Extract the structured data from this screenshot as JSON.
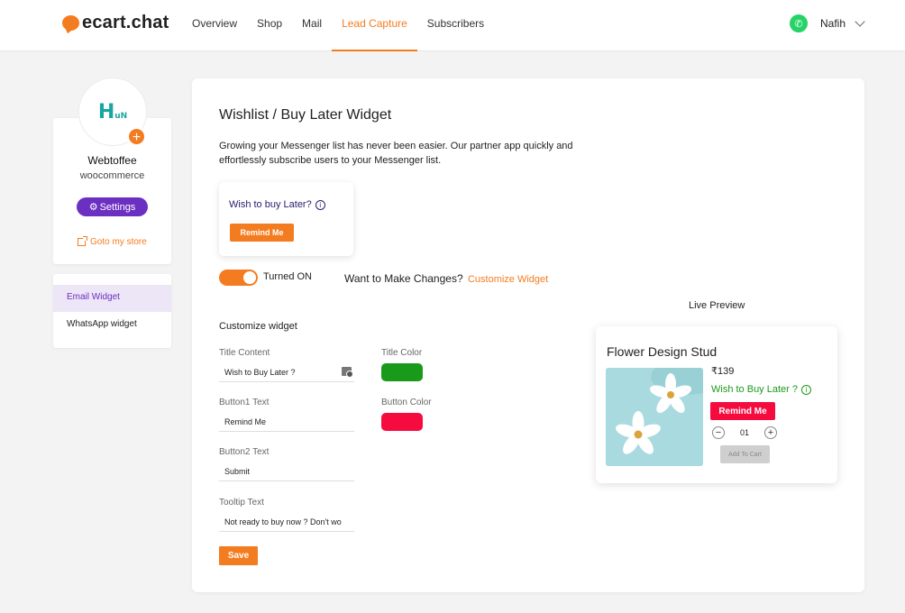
{
  "header": {
    "brand": "ecart.chat",
    "nav": [
      "Overview",
      "Shop",
      "Mail",
      "Lead Capture",
      "Subscribers"
    ],
    "active_nav": "Lead Capture",
    "user_name": "Nafih"
  },
  "sidebar": {
    "store_name": "Webtoffee",
    "platform": "woocommerce",
    "settings_label": "Settings",
    "store_link": "Goto my store",
    "widgets": [
      "Email Widget",
      "WhatsApp widget"
    ]
  },
  "main": {
    "title": "Wishlist / Buy Later Widget",
    "description": "Growing your Messenger list has never been easier. Our partner app quickly and effortlessly subscribe users to your Messenger list.",
    "preview": {
      "title": "Wish to buy Later?",
      "button": "Remind Me"
    },
    "toggle_label": "Turned ON",
    "changes_text": "Want to Make Changes?",
    "customize_link": "Customize Widget",
    "live_preview_label": "Live Preview",
    "customize_title": "Customize widget",
    "fields": {
      "title_content": {
        "label": "Title Content",
        "value": "Wish to Buy Later ?"
      },
      "button1": {
        "label": "Button1 Text",
        "value": "Remind Me"
      },
      "button2": {
        "label": "Button2 Text",
        "value": "Submit"
      },
      "tooltip": {
        "label": "Tooltip Text",
        "value": "Not ready to buy now ? Don't wo"
      }
    },
    "title_color_label": "Title Color",
    "button_color_label": "Button Color",
    "save_label": "Save"
  },
  "live_preview": {
    "product": "Flower Design Stud",
    "price": "₹139",
    "wish_text": "Wish to Buy Later ?",
    "remind_button": "Remind Me",
    "quantity": "01",
    "add_to_cart": "Add To Cart"
  },
  "colors": {
    "accent": "#f47c20",
    "brand_purple": "#6b2fc2",
    "title_color": "#1a9a1a",
    "button_color": "#f50b3e"
  }
}
